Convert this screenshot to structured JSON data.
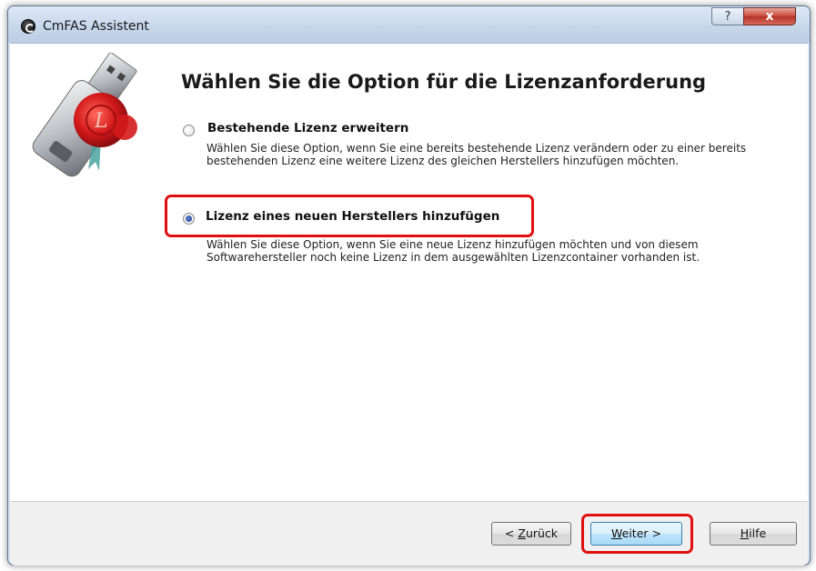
{
  "window": {
    "title": "CmFAS Assistent",
    "help_glyph": "?",
    "close_glyph": "x"
  },
  "main": {
    "heading": "Wählen Sie die Option für die Lizenzanforderung",
    "options": [
      {
        "label": "Bestehende Lizenz erweitern",
        "description": "Wählen Sie diese Option, wenn Sie eine bereits bestehende Lizenz verändern oder zu einer bereits bestehenden Lizenz eine weitere Lizenz des gleichen Herstellers hinzufügen möchten.",
        "selected": false
      },
      {
        "label": "Lizenz eines neuen Herstellers hinzufügen",
        "description": "Wählen Sie diese Option, wenn Sie eine neue Lizenz hinzufügen möchten und von diesem Softwarehersteller noch keine Lizenz in dem ausgewählten Lizenzcontainer vorhanden ist.",
        "selected": true
      }
    ],
    "hero_icon": "usb-dongle-with-wax-seal-icon"
  },
  "footer": {
    "back_prefix": "< ",
    "back_mnemonic": "Z",
    "back_rest": "urück",
    "next_mnemonic": "W",
    "next_rest": "eiter >",
    "help_mnemonic": "H",
    "help_rest": "ilfe"
  },
  "colors": {
    "highlight": "#e01010",
    "titlebar": "#c6d6ea",
    "close_button": "#c9473a"
  }
}
